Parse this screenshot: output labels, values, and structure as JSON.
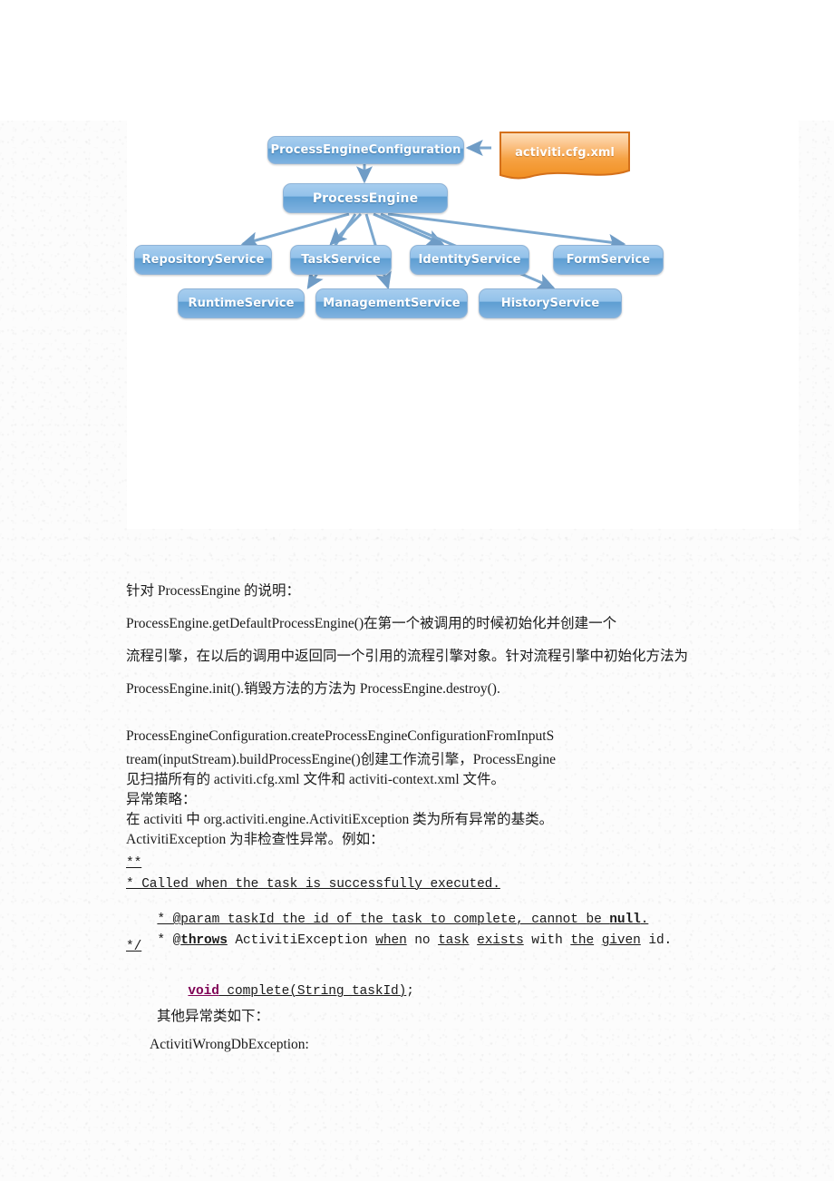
{
  "document": {
    "figure": {
      "title": "Activiti ProcessEngine architecture diagram",
      "nodes": {
        "config": "ProcessEngineConfiguration",
        "engine": "ProcessEngine",
        "note": "activiti.cfg.xml",
        "repository_service": "RepositoryService",
        "task_service": "TaskService",
        "identity_service": "IdentityService",
        "form_service": "FormService",
        "runtime_service": "RuntimeService",
        "management_service": "ManagementService",
        "history_service": "HistoryService"
      },
      "colors": {
        "box_fill_light": "#a7cdee",
        "box_fill_dark": "#5d9ed2",
        "box_border": "#8fb4d8",
        "note_fill_top": "#fbc98e",
        "note_fill_bottom": "#f18f21",
        "note_border": "#d4701a",
        "arrow": "#7ba7ce",
        "label_text": "#ffffff"
      }
    },
    "body": {
      "line_01": "针对 ProcessEngine 的说明：",
      "line_02": "ProcessEngine.getDefaultProcessEngine()在第一个被调用的时候初始化并创建一个",
      "line_03": "流程引擎，在以后的调用中返回同一个引用的流程引擎对象。针对流程引擎中初始化方法为",
      "line_04": "ProcessEngine.init().销毁方法的方法为 ProcessEngine.destroy().",
      "line_05": "ProcessEngineConfiguration.createProcessEngineConfigurationFromInputS",
      "line_06": "tream(inputStream).buildProcessEngine()创建工作流引擎，ProcessEngine",
      "line_07": "见扫描所有的 activiti.cfg.xml 文件和 activiti-context.xml 文件。",
      "line_08": "异常策略：",
      "line_09": "在 activiti 中 org.activiti.engine.ActivitiException 类为所有异常的基类。",
      "line_10": "ActivitiException 为非检查性异常。例如：",
      "code_01": "**",
      "code_02": "* Called when the task is successfully executed.",
      "code_03_a": "* @param taskId the id of the task to complete, cannot be ",
      "code_03_b": "null",
      "code_03_c": ".",
      "code_04_a": "* @",
      "code_04_b": "throws",
      "code_04_c": " ActivitiException ",
      "code_04_d": "when",
      "code_04_e": " no ",
      "code_04_f": "task",
      "code_04_g": " ",
      "code_04_h": "exists",
      "code_04_i": " with ",
      "code_04_j": "the",
      "code_04_k": " ",
      "code_04_l": "given",
      "code_04_m": " id.",
      "code_05": "*/",
      "code_06_a": "void",
      "code_06_b": " complete(String taskId)",
      "code_06_c": ";",
      "line_11": "其他异常类如下：",
      "line_12": "ActivitiWrongDbException:"
    }
  }
}
